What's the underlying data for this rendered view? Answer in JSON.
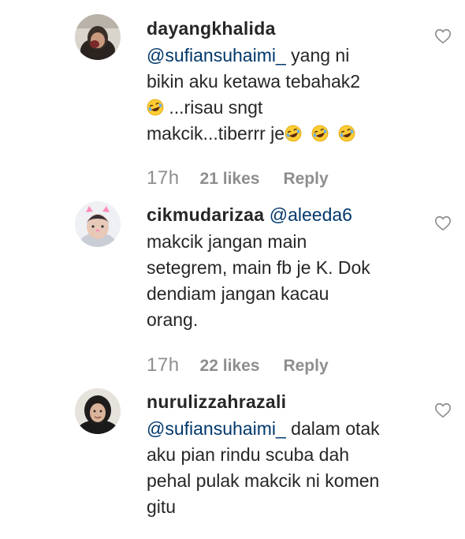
{
  "comments": [
    {
      "username": "dayangkhalida",
      "mention": "@sufiansuhaimi_",
      "lines": [
        {
          "text": " yang ni"
        },
        {
          "text": "bikin aku ketawa tebahak2"
        },
        {
          "emoji_before": "rofl-emoji",
          "text": " ...risau sngt"
        },
        {
          "text": "makcik...tiberrr je",
          "emoji_after": 3
        }
      ],
      "time": "17h",
      "likes": "21 likes",
      "reply": "Reply"
    },
    {
      "username": "cikmudarizaa",
      "mention": "@aleeda6",
      "lines": [
        {
          "text": "makcik jangan main"
        },
        {
          "text": "setegrem, main fb je K. Dok"
        },
        {
          "text": "dendiam jangan kacau"
        },
        {
          "text": "orang."
        }
      ],
      "time": "17h",
      "likes": "22 likes",
      "reply": "Reply"
    },
    {
      "username": "nurulizzahrazali",
      "mention": "@sufiansuhaimi_",
      "lines": [
        {
          "text": " dalam otak"
        },
        {
          "text": "aku pian rindu scuba dah"
        },
        {
          "text": "pehal pulak makcik ni komen"
        },
        {
          "text": "gitu"
        }
      ]
    }
  ],
  "colors": {
    "text": "#262626",
    "mention": "#00376b",
    "secondary": "#8e8e8e"
  }
}
